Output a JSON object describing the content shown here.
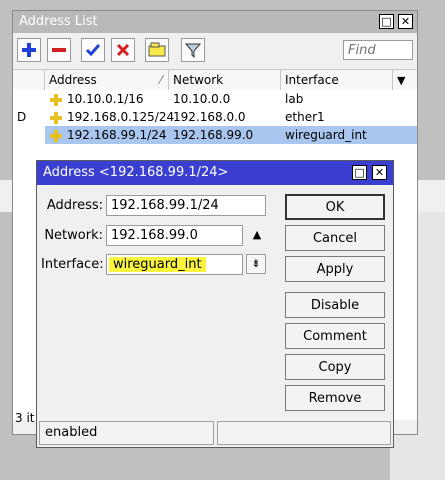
{
  "address_list": {
    "title": "Address List",
    "find_placeholder": "Find",
    "columns": [
      "Address",
      "Network",
      "Interface"
    ],
    "rows": [
      {
        "flag": "",
        "address": "10.10.0.1/16",
        "network": "10.10.0.0",
        "interface": "lab"
      },
      {
        "flag": "D",
        "address": "192.168.0.125/24",
        "network": "192.168.0.0",
        "interface": "ether1"
      },
      {
        "flag": "",
        "address": "192.168.99.1/24",
        "network": "192.168.99.0",
        "interface": "wireguard_int"
      }
    ],
    "status": "3 it"
  },
  "dialog": {
    "title": "Address <192.168.99.1/24>",
    "address_label": "Address:",
    "address_value": "192.168.99.1/24",
    "network_label": "Network:",
    "network_value": "192.168.99.0",
    "interface_label": "Interface:",
    "interface_value": "wireguard_int",
    "buttons": {
      "ok": "OK",
      "cancel": "Cancel",
      "apply": "Apply",
      "disable": "Disable",
      "comment": "Comment",
      "copy": "Copy",
      "remove": "Remove"
    },
    "status": "enabled"
  },
  "colors": {
    "dialog_title": "#3a3fd1",
    "selected_row": "#a8c6ee",
    "highlight": "#fbf43d",
    "add_icon": "#1f3fd6",
    "remove_icon": "#d21f1f"
  }
}
